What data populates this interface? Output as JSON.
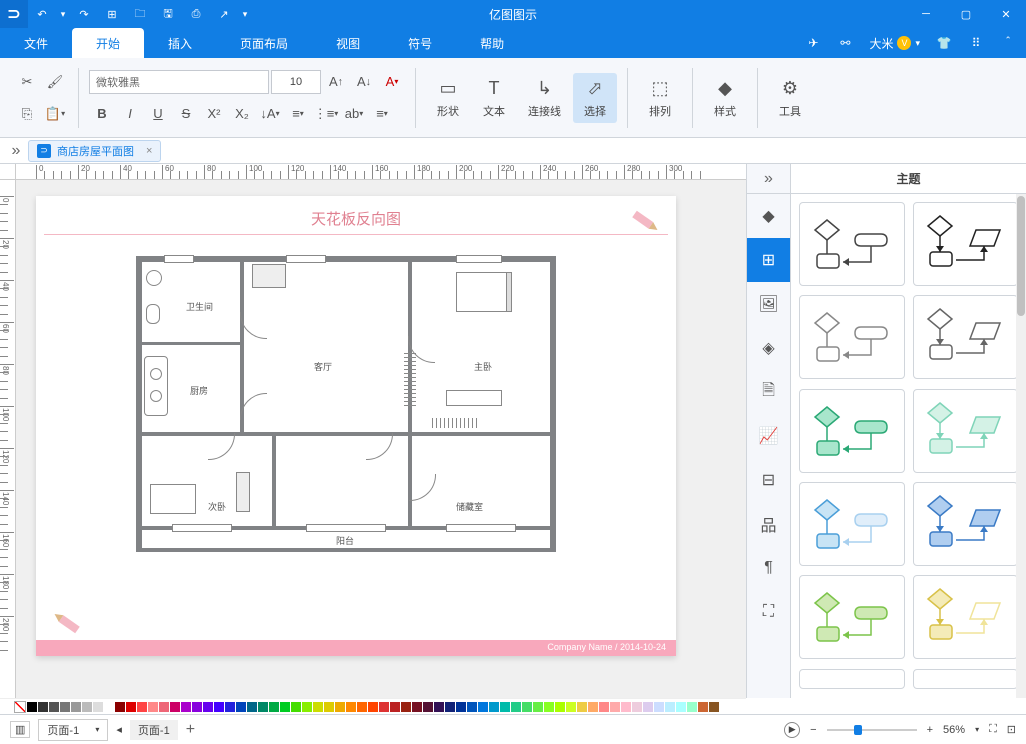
{
  "app_title": "亿图图示",
  "menu": {
    "file": "文件",
    "start": "开始",
    "insert": "插入",
    "layout": "页面布局",
    "view": "视图",
    "symbol": "符号",
    "help": "帮助"
  },
  "user": {
    "name": "大米"
  },
  "ribbon": {
    "font": "微软雅黑",
    "size": "10",
    "shape": "形状",
    "text": "文本",
    "connector": "连接线",
    "select": "选择",
    "arrange": "排列",
    "style": "样式",
    "tools": "工具"
  },
  "doc_tab": "商店房屋平面图",
  "ruler_h": [
    "0",
    "20",
    "40",
    "60",
    "80",
    "100",
    "120",
    "140",
    "160",
    "180",
    "200",
    "220",
    "240",
    "260",
    "280",
    "300"
  ],
  "ruler_v": [
    "0",
    "20",
    "40",
    "60",
    "80",
    "100",
    "120",
    "140",
    "160",
    "180",
    "200"
  ],
  "page": {
    "title": "天花板反向图",
    "footer": "Company Name / 2014-10-24",
    "rooms": {
      "bath": "卫生间",
      "kitchen": "厨房",
      "living": "客厅",
      "master": "主卧",
      "second": "次卧",
      "storage": "储藏室",
      "balcony": "阳台"
    }
  },
  "side": {
    "title": "主题"
  },
  "status": {
    "page_dropdown": "页面-1",
    "page_tab": "页面-1",
    "zoom": "56%"
  },
  "theme_colors": [
    [
      "#444",
      "#444"
    ],
    [
      "#222",
      "#222"
    ],
    [
      "#888",
      "#888"
    ],
    [
      "#666",
      "#666"
    ],
    [
      "#2aa875",
      "#2aa875"
    ],
    [
      "#7fd4b8",
      "#7fd4b8"
    ],
    [
      "#4a9ed8",
      "#a8d0ef"
    ],
    [
      "#3a7ac5",
      "#3a7ac5"
    ],
    [
      "#7cc44a",
      "#7cc44a"
    ],
    [
      "#d8c148",
      "#f0e49a"
    ]
  ],
  "palette": [
    "#000",
    "#333",
    "#555",
    "#777",
    "#999",
    "#bbb",
    "#ddd",
    "#fff",
    "#8b0000",
    "#d00",
    "#f44",
    "#f88",
    "#e67",
    "#c06",
    "#a0c",
    "#80d",
    "#60e",
    "#40f",
    "#22d",
    "#04b",
    "#068",
    "#086",
    "#0a4",
    "#0c2",
    "#4d0",
    "#8e0",
    "#cd0",
    "#dc0",
    "#ea0",
    "#f80",
    "#f60",
    "#f40",
    "#d33",
    "#b22",
    "#921",
    "#712",
    "#513",
    "#315",
    "#127",
    "#039",
    "#05b",
    "#07d",
    "#09c",
    "#0ba",
    "#2c8",
    "#4d6",
    "#6e4",
    "#8f2",
    "#af0",
    "#cf2",
    "#ec4",
    "#fa6",
    "#f88",
    "#faa",
    "#fbc",
    "#ecd",
    "#dce",
    "#cdf",
    "#bef",
    "#aff",
    "#9fc",
    "#c63",
    "#852"
  ]
}
